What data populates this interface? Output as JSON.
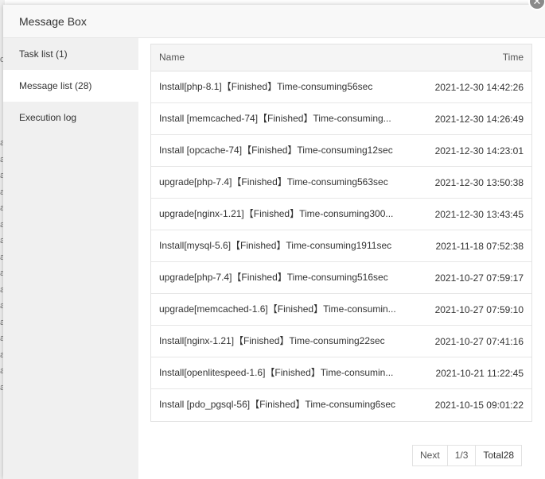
{
  "dialog": {
    "title": "Message Box",
    "close_glyph": "✕"
  },
  "background": {
    "chars": [
      "ol",
      "a",
      "a",
      "a",
      "a",
      "a",
      "a",
      "a",
      "a",
      "a",
      "a",
      "a",
      "a",
      "a",
      "a",
      "a",
      "a"
    ]
  },
  "sidebar": {
    "items": [
      {
        "label": "Task list (1)",
        "active": false
      },
      {
        "label": "Message list (28)",
        "active": true
      },
      {
        "label": "Execution log",
        "active": false
      }
    ]
  },
  "table": {
    "columns": {
      "name": "Name",
      "time": "Time"
    },
    "rows": [
      {
        "name": "Install[php-8.1]【Finished】Time-consuming56sec",
        "time": "2021-12-30 14:42:26"
      },
      {
        "name": "Install [memcached-74]【Finished】Time-consuming...",
        "time": "2021-12-30 14:26:49"
      },
      {
        "name": "Install [opcache-74]【Finished】Time-consuming12sec",
        "time": "2021-12-30 14:23:01"
      },
      {
        "name": "upgrade[php-7.4]【Finished】Time-consuming563sec",
        "time": "2021-12-30 13:50:38"
      },
      {
        "name": "upgrade[nginx-1.21]【Finished】Time-consuming300...",
        "time": "2021-12-30 13:43:45"
      },
      {
        "name": "Install[mysql-5.6]【Finished】Time-consuming1911sec",
        "time": "2021-11-18 07:52:38"
      },
      {
        "name": "upgrade[php-7.4]【Finished】Time-consuming516sec",
        "time": "2021-10-27 07:59:17"
      },
      {
        "name": "upgrade[memcached-1.6]【Finished】Time-consumin...",
        "time": "2021-10-27 07:59:10"
      },
      {
        "name": "Install[nginx-1.21]【Finished】Time-consuming22sec",
        "time": "2021-10-27 07:41:16"
      },
      {
        "name": "Install[openlitespeed-1.6]【Finished】Time-consumin...",
        "time": "2021-10-21 11:22:45"
      },
      {
        "name": "Install [pdo_pgsql-56]【Finished】Time-consuming6sec",
        "time": "2021-10-15 09:01:22"
      }
    ]
  },
  "pagination": {
    "next_label": "Next",
    "page_indicator": "1/3",
    "total_label": "Total28"
  }
}
